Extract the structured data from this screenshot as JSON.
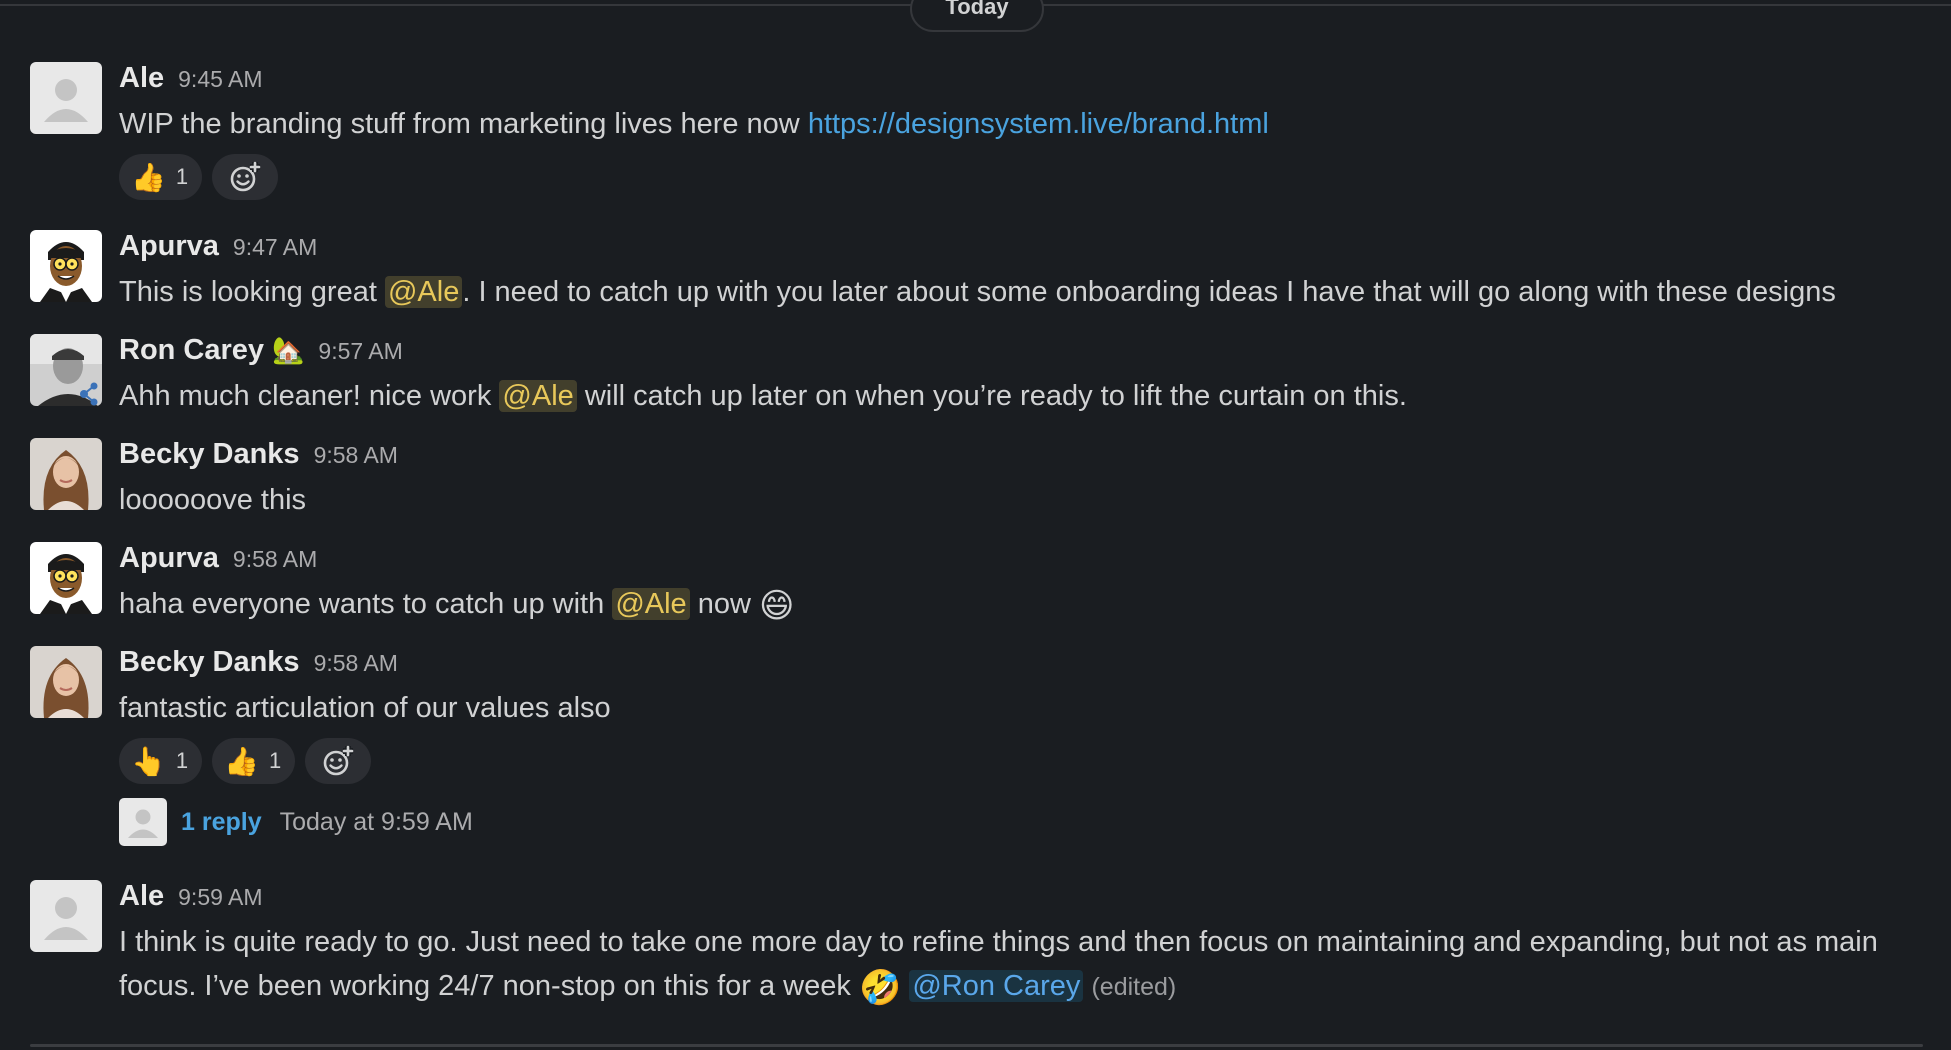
{
  "day_divider": {
    "label": "Today"
  },
  "messages": [
    {
      "author": "Ale",
      "time": "9:45 AM",
      "text_before_link": "WIP the branding  stuff from marketing lives here now ",
      "link": "https://designsystem.live/brand.html",
      "reactions": [
        {
          "emoji": "👍",
          "count": "1"
        }
      ]
    },
    {
      "author": "Apurva",
      "time": "9:47 AM",
      "text_before": "This is looking great ",
      "mention": "@Ale",
      "text_after": ". I need to catch up with you later about some onboarding ideas I have that will go along with these designs"
    },
    {
      "author": "Ron Carey",
      "status_emoji": "🏡",
      "time": "9:57 AM",
      "text_before": "Ahh much cleaner!  nice work ",
      "mention": "@Ale",
      "text_after": " will catch up later on when you’re ready to lift the curtain on this."
    },
    {
      "author": "Becky Danks",
      "time": "9:58 AM",
      "text": "loooooove this"
    },
    {
      "author": "Apurva",
      "time": "9:58 AM",
      "text_before": "haha everyone wants to catch up with ",
      "mention": "@Ale",
      "text_after": " now ",
      "emoji": "😄"
    },
    {
      "author": "Becky Danks",
      "time": "9:58 AM",
      "text": "fantastic articulation of our values also",
      "reactions": [
        {
          "emoji": "👆",
          "count": "1"
        },
        {
          "emoji": "👍",
          "count": "1"
        }
      ],
      "thread": {
        "reply_label": "1 reply",
        "reply_time": "Today at 9:59 AM"
      }
    },
    {
      "author": "Ale",
      "time": "9:59 AM",
      "text_line1": "I think is quite ready to go. Just need to take one more day to refine things and then focus on maintaining and expanding, but not as main",
      "text_line2": "focus. I’ve been working 24/7 non-stop on this for a week ",
      "emoji": "🤣",
      "mention": "@Ron Carey",
      "edited": "(edited)"
    }
  ],
  "colors": {
    "background": "#1a1d21",
    "link": "#4aa3df",
    "mention_self": "#e8c85a",
    "mention_other": "#5aa7ea"
  }
}
